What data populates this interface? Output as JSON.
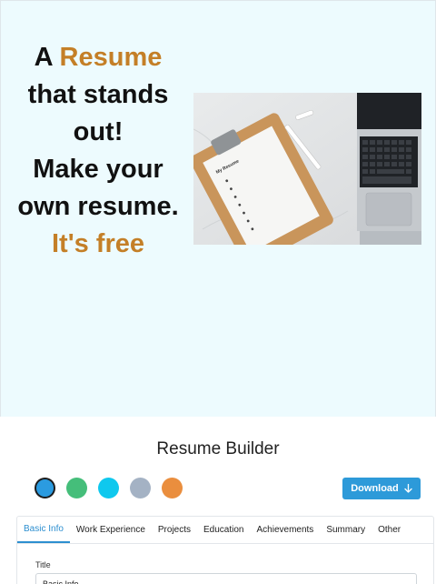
{
  "hero": {
    "headline": {
      "part1": "A ",
      "part2": "Resume",
      "part3": "that stands out!",
      "part4": "Make your own resume.",
      "part5": "It's free"
    },
    "image": {
      "clipboard_heading": "My Resume"
    },
    "accent_color": "#c47f27"
  },
  "builder": {
    "title": "Resume Builder",
    "colors": [
      "#2b9be0",
      "#45be7a",
      "#0fc8ee",
      "#a4b2c4",
      "#ea8e3e"
    ],
    "selected_color_index": 0,
    "download_label": "Download",
    "tabs": [
      "Basic Info",
      "Work Experience",
      "Projects",
      "Education",
      "Achievements",
      "Summary",
      "Other"
    ],
    "active_tab_index": 0,
    "form": {
      "title_label": "Title",
      "title_value": "Basic Info"
    }
  }
}
